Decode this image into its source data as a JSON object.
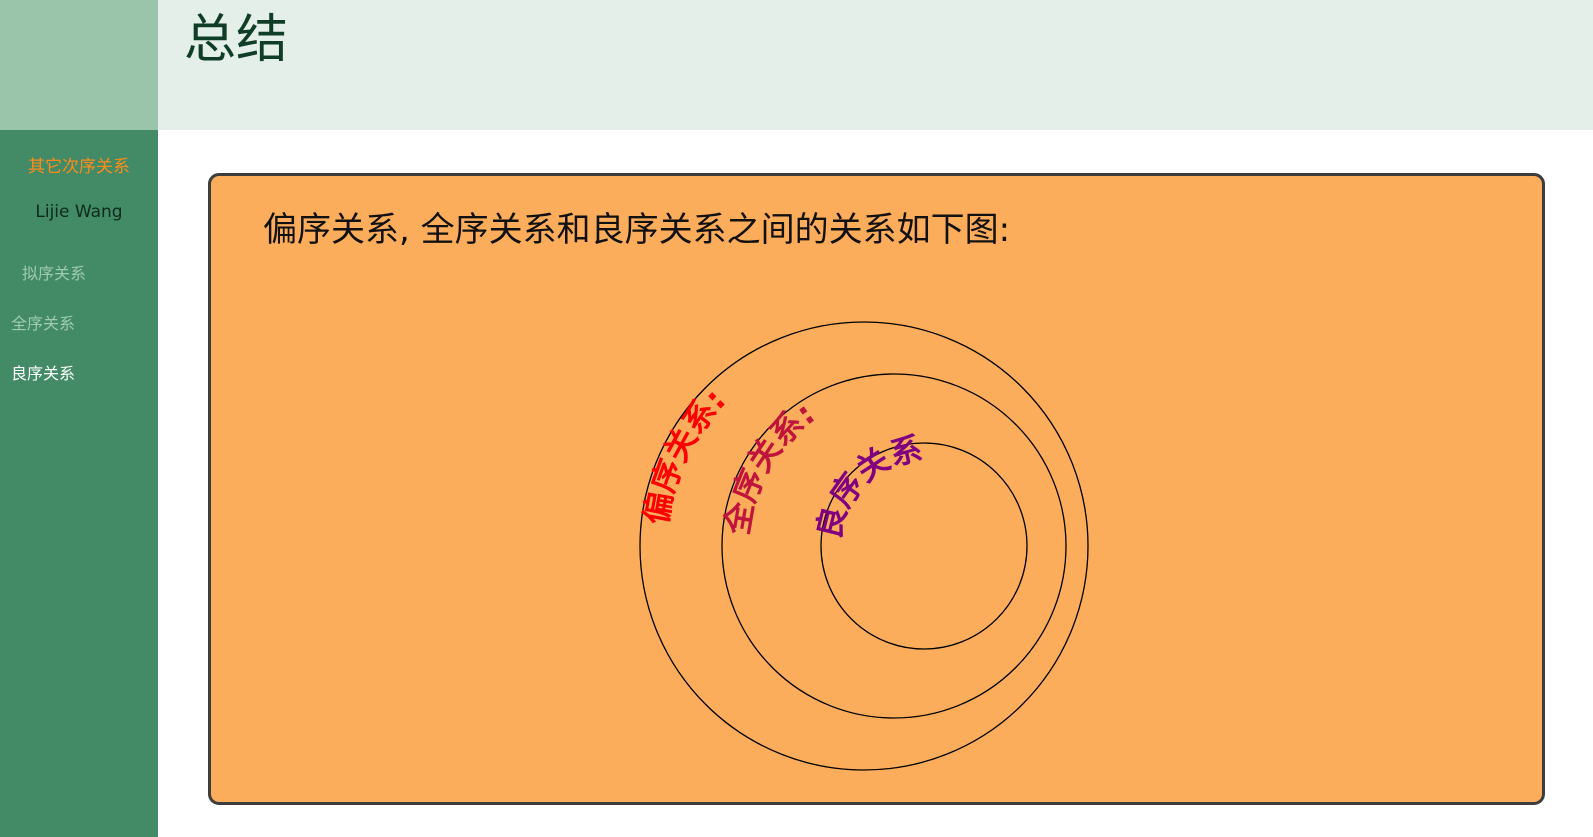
{
  "header": {
    "title": "总结"
  },
  "sidebar": {
    "section_title": "其它次序关系",
    "author": "Lijie Wang",
    "items": [
      {
        "label": "拟序关系",
        "active": false
      },
      {
        "label": "全序关系",
        "active": false
      },
      {
        "label": "良序关系",
        "active": true
      }
    ]
  },
  "slide": {
    "text": "偏序关系, 全序关系和良序关系之间的关系如下图:",
    "diagram": {
      "labels": [
        {
          "text": "偏序关系:",
          "color": "#ff0000"
        },
        {
          "text": "全序关系:",
          "color": "#c0143c"
        },
        {
          "text": "良序关系:",
          "color": "#800080"
        }
      ]
    }
  },
  "colors": {
    "sidebar": "#428b66",
    "header": "#e4efe9",
    "frame_bg": "#fcad5c",
    "accent": "#ff8c1a"
  }
}
